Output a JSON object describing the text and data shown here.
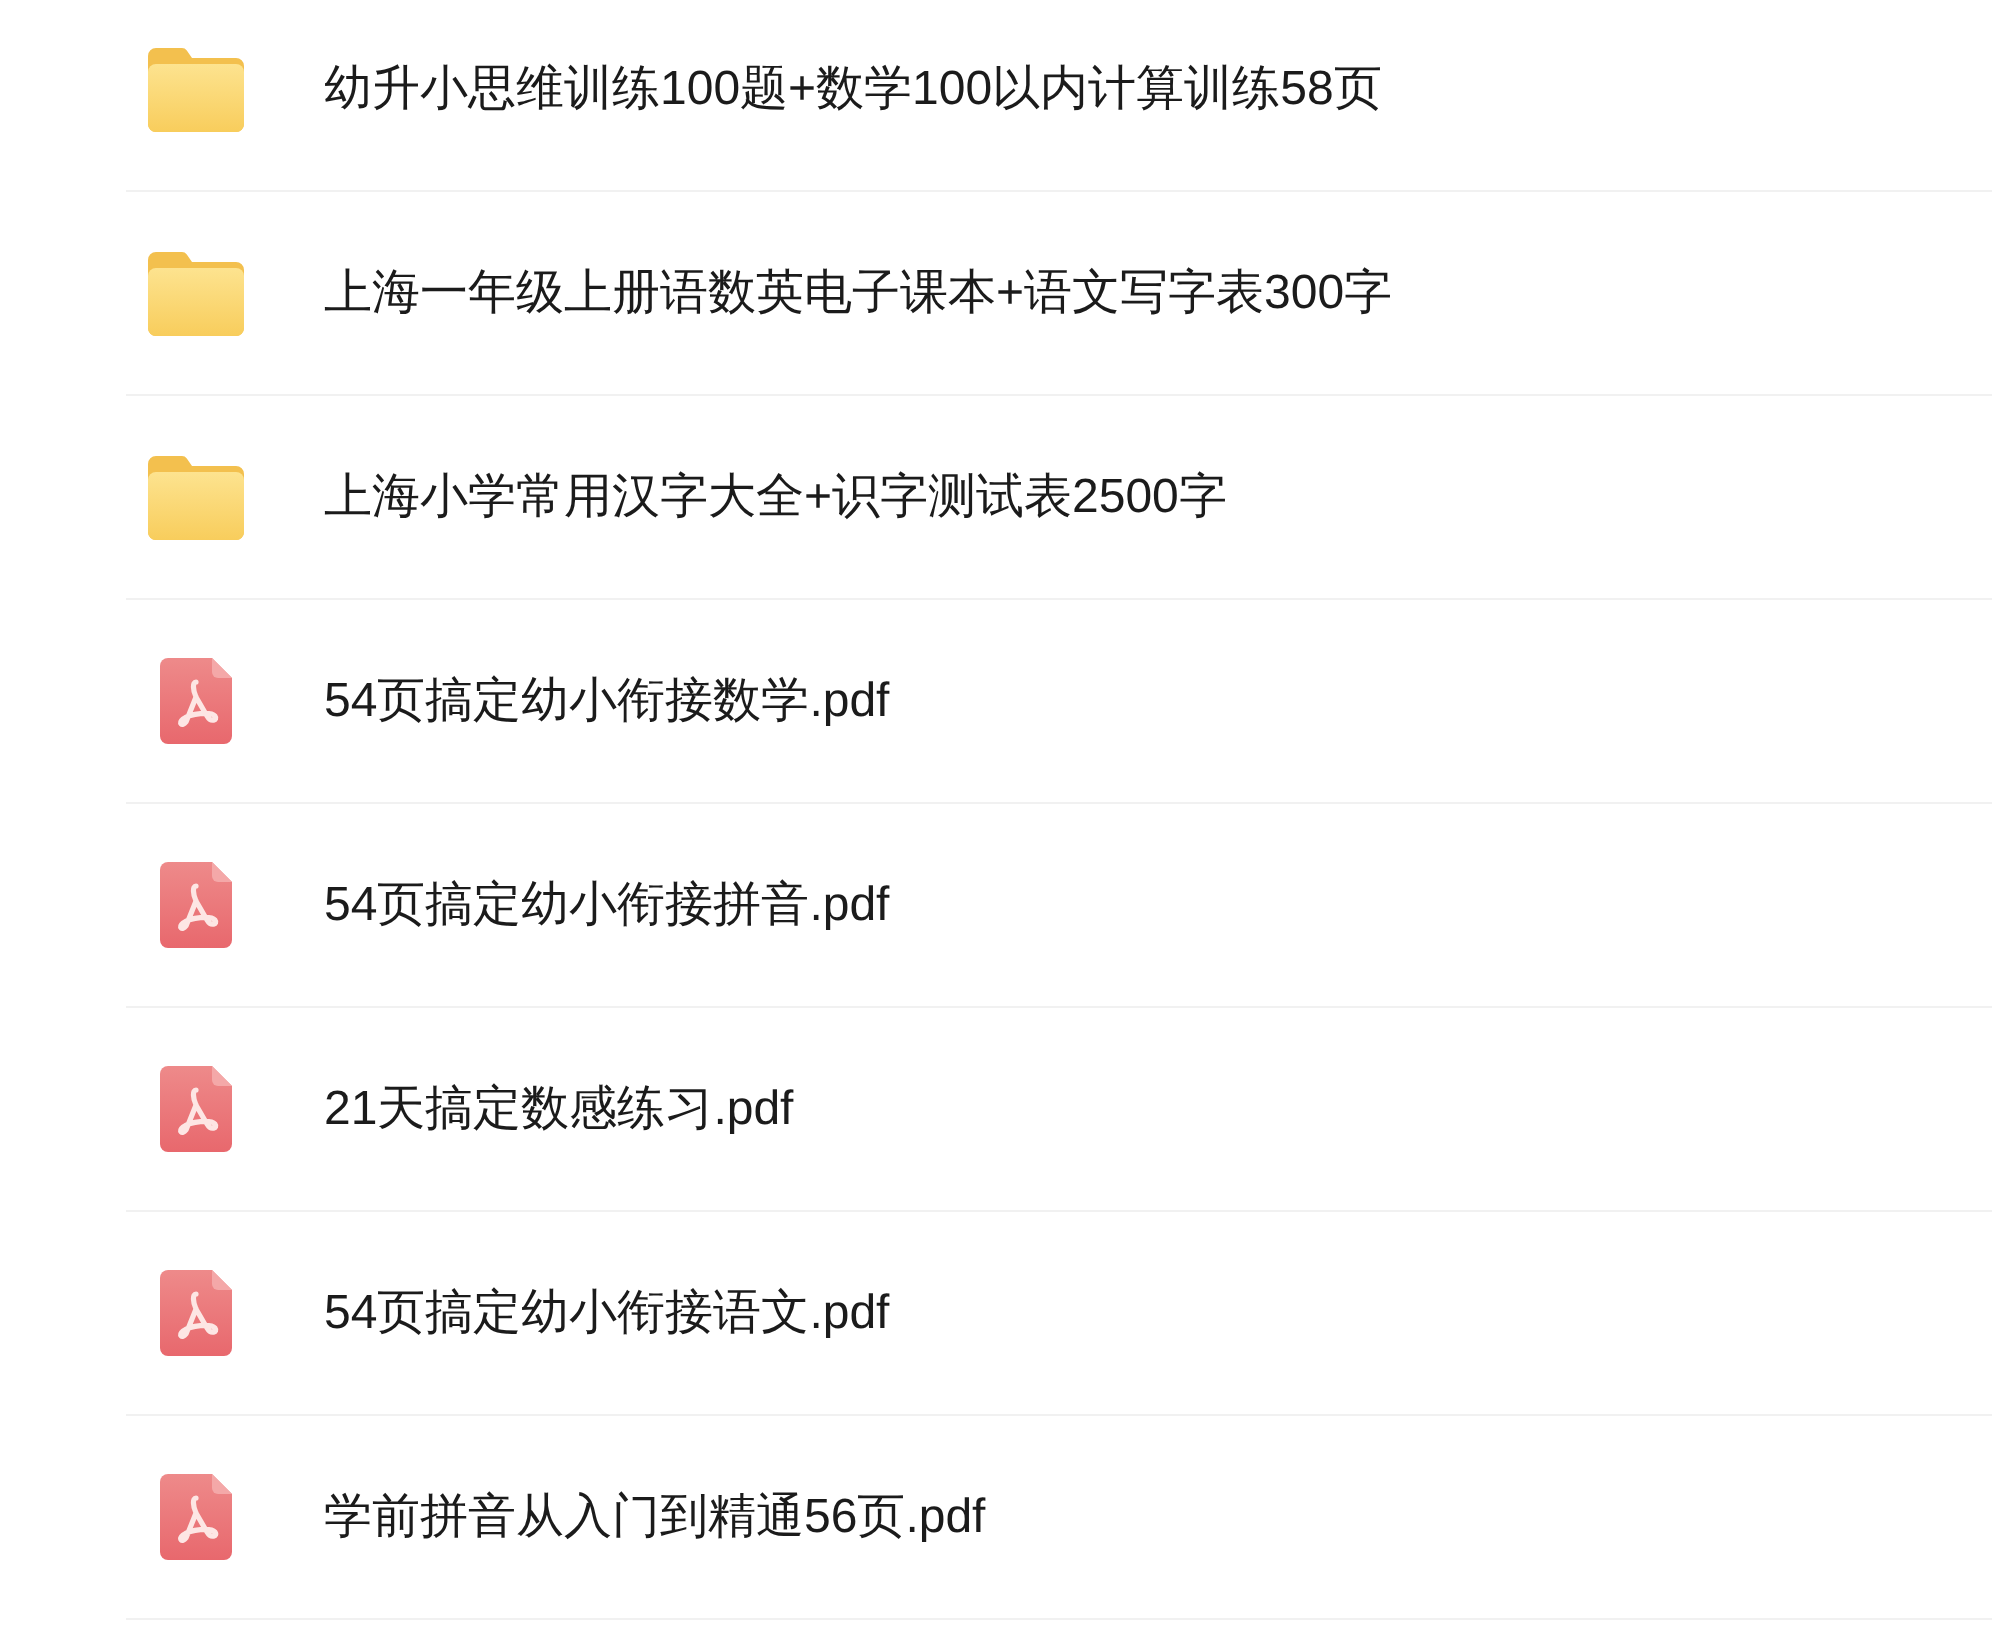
{
  "files": [
    {
      "kind": "folder",
      "name": "幼升小思维训练100题+数学100以内计算训练58页"
    },
    {
      "kind": "folder",
      "name": "上海一年级上册语数英电子课本+语文写字表300字"
    },
    {
      "kind": "folder",
      "name": "上海小学常用汉字大全+识字测试表2500字"
    },
    {
      "kind": "pdf",
      "name": "54页搞定幼小衔接数学.pdf"
    },
    {
      "kind": "pdf",
      "name": "54页搞定幼小衔接拼音.pdf"
    },
    {
      "kind": "pdf",
      "name": "21天搞定数感练习.pdf"
    },
    {
      "kind": "pdf",
      "name": "54页搞定幼小衔接语文.pdf"
    },
    {
      "kind": "pdf",
      "name": "学前拼音从入门到精通56页.pdf"
    }
  ]
}
